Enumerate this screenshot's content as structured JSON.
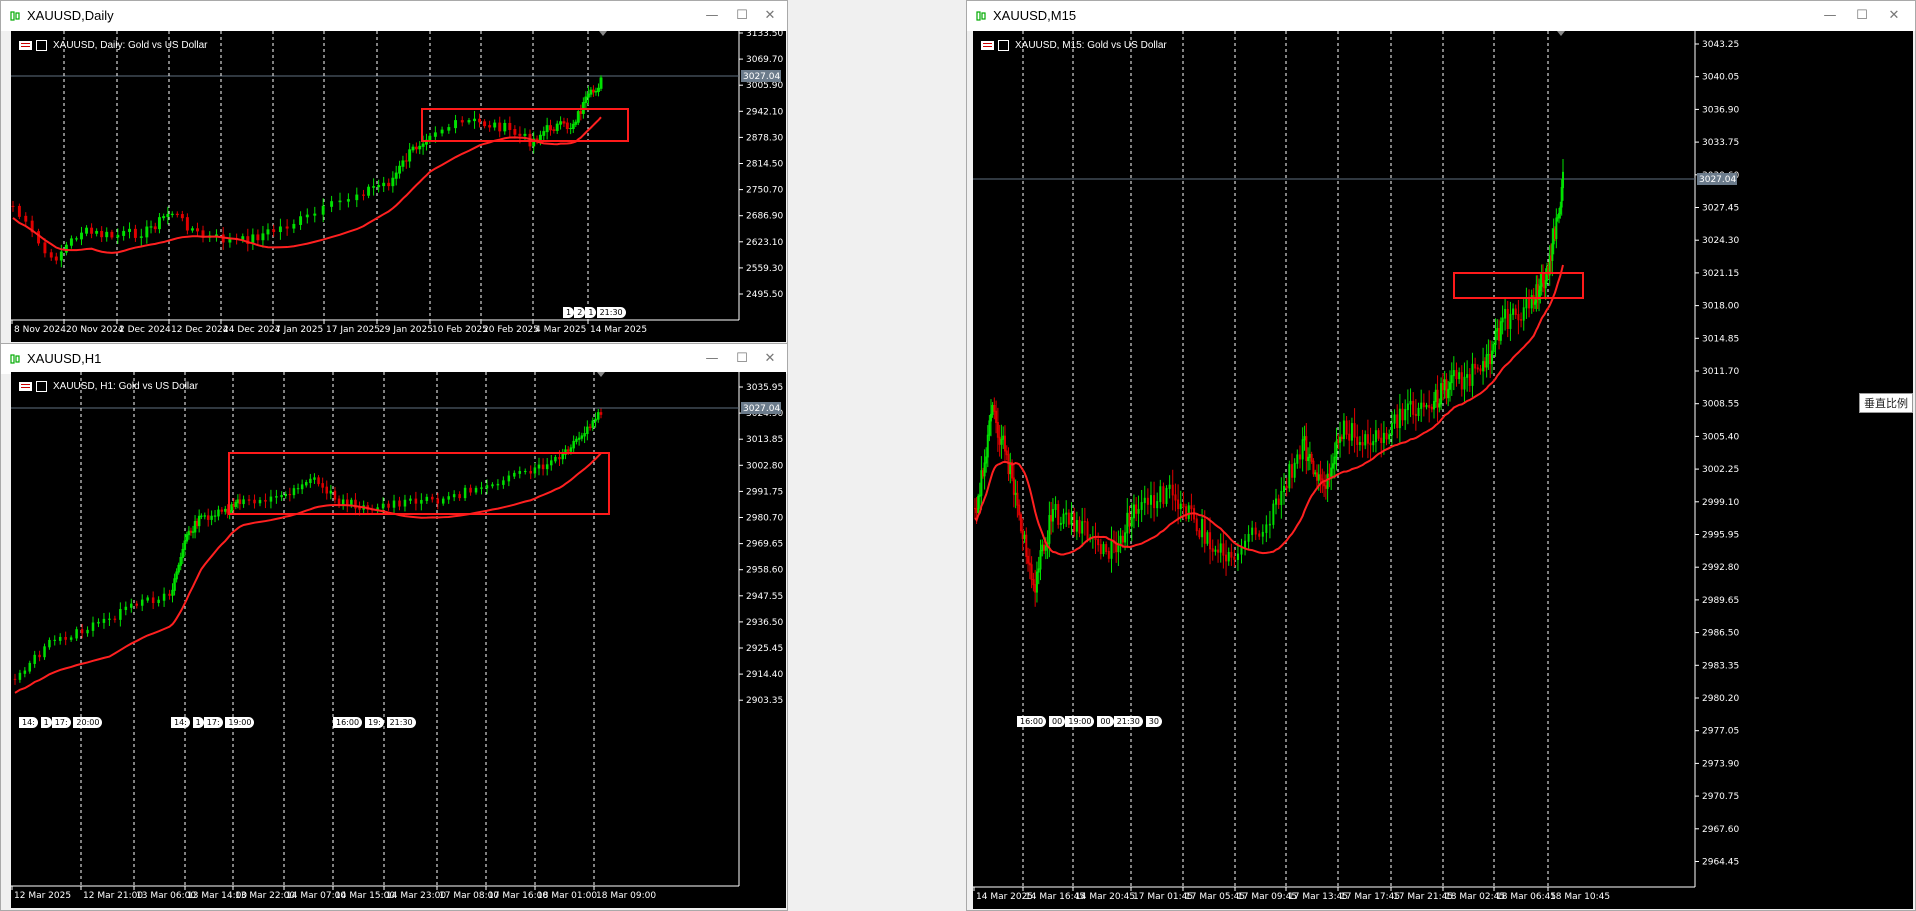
{
  "windows": [
    {
      "id": "daily",
      "title": "XAUUSD,Daily",
      "header": "XAUUSD, Daily:  Gold vs US Dollar",
      "price_labels": [
        "3133.50",
        "3069.70",
        "3005.90",
        "2942.10",
        "2878.30",
        "2814.50",
        "2750.70",
        "2686.90",
        "2623.10",
        "2559.30",
        "2495.50"
      ],
      "current_price": "3027.04",
      "time_labels": [
        "8 Nov 2024",
        "20 Nov 2024",
        "2 Dec 2024",
        "12 Dec 2024",
        "24 Dec 2024",
        "7 Jan 2025",
        "17 Jan 2025",
        "29 Jan 2025",
        "10 Feb 2025",
        "20 Feb 2025",
        "4 Mar 2025",
        "14 Mar 2025"
      ],
      "tip_labels": [
        "1",
        "2",
        "1",
        "21:30"
      ]
    },
    {
      "id": "h1",
      "title": "XAUUSD,H1",
      "header": "XAUUSD, H1:  Gold vs US Dollar",
      "price_labels": [
        "3035.95",
        "3024.90",
        "3013.85",
        "3002.80",
        "2991.75",
        "2980.70",
        "2969.65",
        "2958.60",
        "2947.55",
        "2936.50",
        "2925.45",
        "2914.40",
        "2903.35"
      ],
      "current_price": "3027.04",
      "time_labels": [
        "12 Mar 2025",
        "12 Mar 21:00",
        "13 Mar 06:00",
        "13 Mar 14:00",
        "13 Mar 22:00",
        "14 Mar 07:00",
        "14 Mar 15:00",
        "14 Mar 23:00",
        "17 Mar 08:00",
        "17 Mar 16:00",
        "18 Mar 01:00",
        "18 Mar 09:00"
      ],
      "tip_groups": [
        [
          "14:",
          "1",
          "17:",
          "20:00"
        ],
        [
          "14:",
          "1",
          "17:",
          "19:00"
        ],
        [
          "16:00",
          "19:",
          "21:30"
        ]
      ]
    },
    {
      "id": "m15",
      "title": "XAUUSD,M15",
      "header": "XAUUSD, M15:  Gold vs US Dollar",
      "price_labels": [
        "3043.25",
        "3040.05",
        "3036.90",
        "3033.75",
        "3030.60",
        "3027.45",
        "3024.30",
        "3021.15",
        "3018.00",
        "3014.85",
        "3011.70",
        "3008.55",
        "3005.40",
        "3002.25",
        "2999.10",
        "2995.95",
        "2992.80",
        "2989.65",
        "2986.50",
        "2983.35",
        "2980.20",
        "2977.05",
        "2973.90",
        "2970.75",
        "2967.60",
        "2964.45"
      ],
      "current_price": "3027.04",
      "time_labels": [
        "14 Mar 2025",
        "14 Mar 16:45",
        "14 Mar 20:45",
        "17 Mar 01:45",
        "17 Mar 05:45",
        "17 Mar 09:45",
        "17 Mar 13:45",
        "17 Mar 17:45",
        "17 Mar 21:45",
        "18 Mar 02:45",
        "18 Mar 06:45",
        "18 Mar 10:45"
      ],
      "tip_labels": [
        "16:00",
        "00",
        "19:00",
        "00",
        "21:30",
        "30"
      ],
      "scale_button": "垂直比例"
    }
  ],
  "colors": {
    "bull": "#00e000",
    "bear": "#e00000",
    "ma": "#ff2020",
    "box": "#ff1a1a",
    "grid": "#ffffff",
    "text": "#ffffff"
  }
}
